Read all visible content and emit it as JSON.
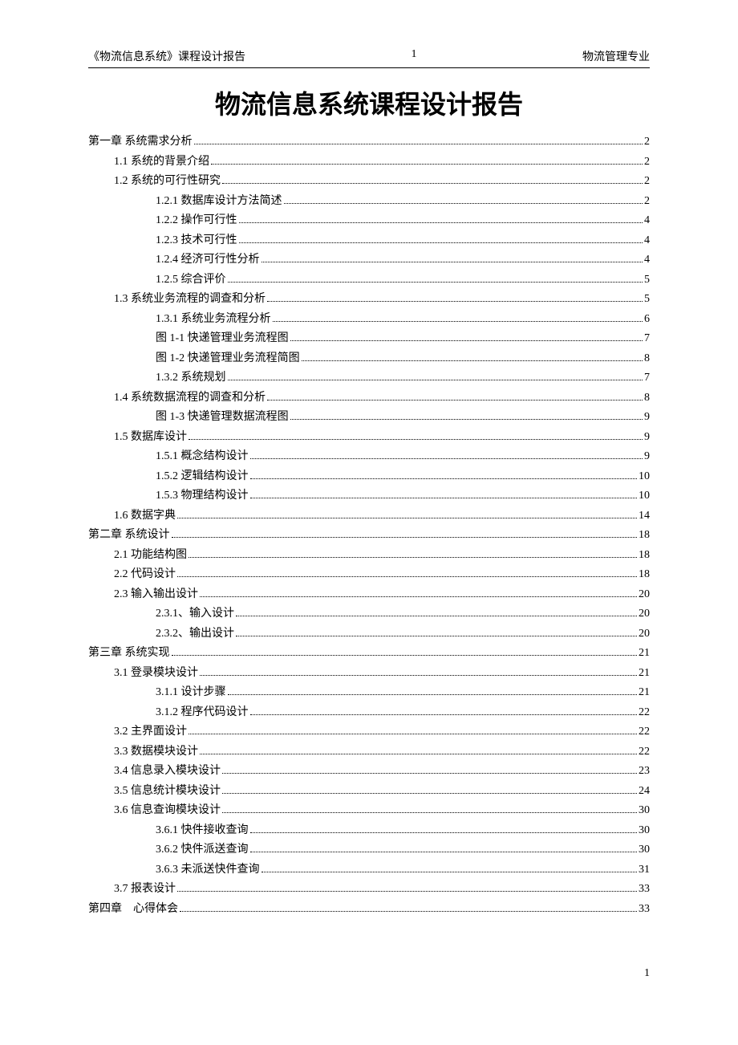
{
  "header": {
    "left": "《物流信息系统》课程设计报告",
    "center": "1",
    "right": "物流管理专业"
  },
  "title": "物流信息系统课程设计报告",
  "toc": [
    {
      "label": "第一章  系统需求分析",
      "page": "2",
      "indent": 0
    },
    {
      "label": "1.1 系统的背景介绍",
      "page": "2",
      "indent": 1
    },
    {
      "label": "1.2 系统的可行性研究",
      "page": "2",
      "indent": 1
    },
    {
      "label": "1.2.1 数据库设计方法简述",
      "page": "2",
      "indent": 2
    },
    {
      "label": "1.2.2 操作可行性",
      "page": "4",
      "indent": 2
    },
    {
      "label": "1.2.3 技术可行性",
      "page": "4",
      "indent": 2
    },
    {
      "label": "1.2.4 经济可行性分析",
      "page": "4",
      "indent": 2
    },
    {
      "label": "1.2.5 综合评价",
      "page": "5",
      "indent": 2
    },
    {
      "label": "1.3 系统业务流程的调查和分析",
      "page": "5",
      "indent": 1
    },
    {
      "label": "1.3.1 系统业务流程分析",
      "page": "6",
      "indent": 2
    },
    {
      "label": "图 1-1 快递管理业务流程图",
      "page": "7",
      "indent": 2
    },
    {
      "label": "图 1-2 快递管理业务流程简图",
      "page": "8",
      "indent": 2
    },
    {
      "label": "1.3.2  系统规划",
      "page": "7",
      "indent": 2
    },
    {
      "label": "1.4 系统数据流程的调查和分析",
      "page": "8",
      "indent": 1
    },
    {
      "label": "图 1-3 快递管理数据流程图",
      "page": "9",
      "indent": 2
    },
    {
      "label": "1.5 数据库设计",
      "page": "9",
      "indent": 1
    },
    {
      "label": "1.5.1 概念结构设计",
      "page": "9",
      "indent": 2
    },
    {
      "label": "1.5.2 逻辑结构设计",
      "page": "10",
      "indent": 2
    },
    {
      "label": "1.5.3 物理结构设计",
      "page": "10",
      "indent": 2
    },
    {
      "label": "1.6 数据字典",
      "page": "14",
      "indent": 1
    },
    {
      "label": "第二章  系统设计",
      "page": "18",
      "indent": 0
    },
    {
      "label": "2.1 功能结构图",
      "page": "18",
      "indent": 1
    },
    {
      "label": "2.2 代码设计",
      "page": "18",
      "indent": 1
    },
    {
      "label": "2.3 输入输出设计",
      "page": "20",
      "indent": 1
    },
    {
      "label": "2.3.1、输入设计",
      "page": "20",
      "indent": 2
    },
    {
      "label": "2.3.2、输出设计",
      "page": "20",
      "indent": 2
    },
    {
      "label": "第三章  系统实现",
      "page": "21",
      "indent": 0
    },
    {
      "label": "3.1 登录模块设计",
      "page": "21",
      "indent": 1
    },
    {
      "label": "3.1.1 设计步骤",
      "page": "21",
      "indent": 2
    },
    {
      "label": "3.1.2 程序代码设计",
      "page": "22",
      "indent": 2
    },
    {
      "label": "3.2 主界面设计",
      "page": "22",
      "indent": 1
    },
    {
      "label": "3.3 数据模块设计",
      "page": "22",
      "indent": 1
    },
    {
      "label": "3.4 信息录入模块设计",
      "page": "23",
      "indent": 1
    },
    {
      "label": "3.5 信息统计模块设计",
      "page": "24",
      "indent": 1
    },
    {
      "label": "3.6 信息查询模块设计",
      "page": "30",
      "indent": 1
    },
    {
      "label": "3.6.1 快件接收查询",
      "page": "30",
      "indent": 2
    },
    {
      "label": "3.6.2 快件派送查询",
      "page": "30",
      "indent": 2
    },
    {
      "label": "3.6.3 未派送快件查询",
      "page": "31",
      "indent": 2
    },
    {
      "label": "3.7 报表设计",
      "page": "33",
      "indent": 1
    },
    {
      "label": "第四章　心得体会",
      "page": "33",
      "indent": 0
    }
  ],
  "footer_page": "1"
}
